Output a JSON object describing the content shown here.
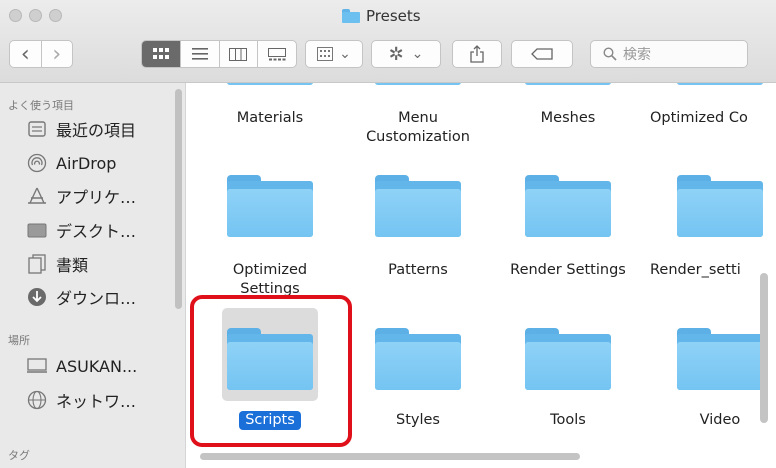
{
  "window": {
    "title": "Presets"
  },
  "toolbar": {
    "back_glyph": "‹",
    "forward_glyph": "›",
    "group_chevron": "⌄",
    "action_chevron": "⌄",
    "search_placeholder": "検索"
  },
  "sidebar": {
    "favorites_header": "よく使う項目",
    "favorites": [
      {
        "label": "最近の項目",
        "icon": "recents-icon"
      },
      {
        "label": "AirDrop",
        "icon": "airdrop-icon"
      },
      {
        "label": "アプリケ…",
        "icon": "applications-icon"
      },
      {
        "label": "デスクト…",
        "icon": "desktop-icon"
      },
      {
        "label": "書類",
        "icon": "documents-icon"
      },
      {
        "label": "ダウンロ…",
        "icon": "downloads-icon"
      }
    ],
    "locations_header": "場所",
    "locations": [
      {
        "label": "ASUKAN...",
        "icon": "computer-icon"
      },
      {
        "label": "ネットワ…",
        "icon": "network-icon"
      }
    ],
    "tags_header": "タグ"
  },
  "content": {
    "row1": [
      "Materials",
      "Menu\nCustomization",
      "Meshes",
      "Optimized Co"
    ],
    "row2": [
      "Optimized\nSettings",
      "Patterns",
      "Render Settings",
      "Render_setti"
    ],
    "row3": [
      "Scripts",
      "Styles",
      "Tools",
      "Video"
    ],
    "selected": "Scripts"
  },
  "colors": {
    "folder": "#74c4f2",
    "selection": "#1a6fd9",
    "highlight_box": "#e0101a"
  }
}
